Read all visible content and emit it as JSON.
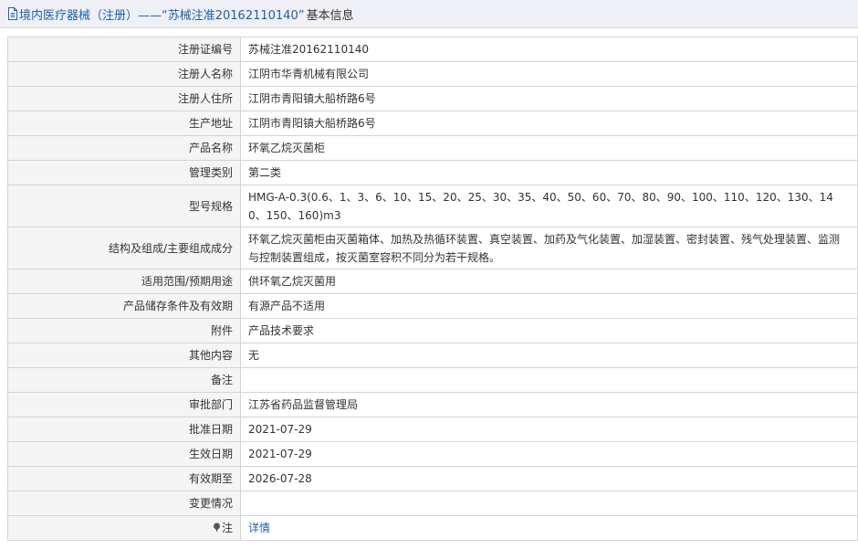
{
  "header": {
    "title": "境内医疗器械（注册）——“苏械注准20162110140”",
    "suffix": "基本信息"
  },
  "rows": [
    {
      "label": "注册证编号",
      "value": "苏械注准20162110140"
    },
    {
      "label": "注册人名称",
      "value": "江阴市华青机械有限公司"
    },
    {
      "label": "注册人住所",
      "value": "江阴市青阳镇大船桥路6号"
    },
    {
      "label": "生产地址",
      "value": "江阴市青阳镇大船桥路6号"
    },
    {
      "label": "产品名称",
      "value": "环氧乙烷灭菌柜"
    },
    {
      "label": "管理类别",
      "value": "第二类"
    },
    {
      "label": "型号规格",
      "value": "HMG-A-0.3(0.6、1、3、6、10、15、20、25、30、35、40、50、60、70、80、90、100、110、120、130、140、150、160)m3"
    },
    {
      "label": "结构及组成/主要组成成分",
      "value": "环氧乙烷灭菌柜由灭菌箱体、加热及热循环装置、真空装置、加药及气化装置、加湿装置、密封装置、残气处理装置、监测与控制装置组成，按灭菌室容积不同分为若干规格。"
    },
    {
      "label": "适用范围/预期用途",
      "value": "供环氧乙烷灭菌用"
    },
    {
      "label": "产品储存条件及有效期",
      "value": "有源产品不适用"
    },
    {
      "label": "附件",
      "value": "产品技术要求"
    },
    {
      "label": "其他内容",
      "value": "无"
    },
    {
      "label": "备注",
      "value": ""
    },
    {
      "label": "审批部门",
      "value": "江苏省药品监督管理局"
    },
    {
      "label": "批准日期",
      "value": "2021-07-29"
    },
    {
      "label": "生效日期",
      "value": "2021-07-29"
    },
    {
      "label": "有效期至",
      "value": "2026-07-28"
    },
    {
      "label": "变更情况",
      "value": ""
    },
    {
      "label": "注",
      "value": "详情"
    }
  ]
}
